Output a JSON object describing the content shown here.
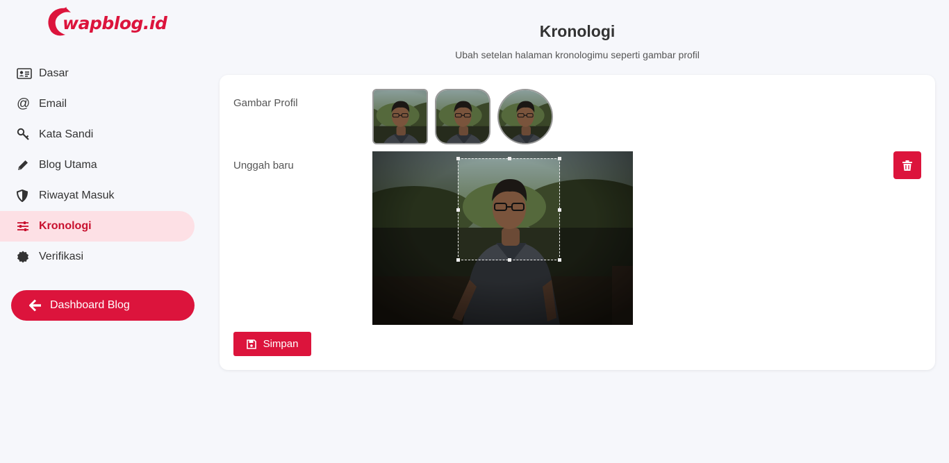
{
  "brand": {
    "logo_text": "wapblog.id",
    "accent": "#dc143c"
  },
  "sidebar": {
    "items": [
      {
        "label": "Dasar",
        "icon": "id-card-icon"
      },
      {
        "label": "Email",
        "icon": "at-icon"
      },
      {
        "label": "Kata Sandi",
        "icon": "key-icon"
      },
      {
        "label": "Blog Utama",
        "icon": "pencil-icon"
      },
      {
        "label": "Riwayat Masuk",
        "icon": "shield-icon"
      },
      {
        "label": "Kronologi",
        "icon": "sliders-icon",
        "active": true
      },
      {
        "label": "Verifikasi",
        "icon": "badge-icon"
      }
    ],
    "dashboard_label": "Dashboard Blog"
  },
  "header": {
    "title": "Kronologi",
    "subtitle": "Ubah setelan halaman kronologimu seperti gambar profil"
  },
  "form": {
    "profile_label": "Gambar Profil",
    "upload_label": "Unggah baru",
    "save_label": "Simpan"
  }
}
